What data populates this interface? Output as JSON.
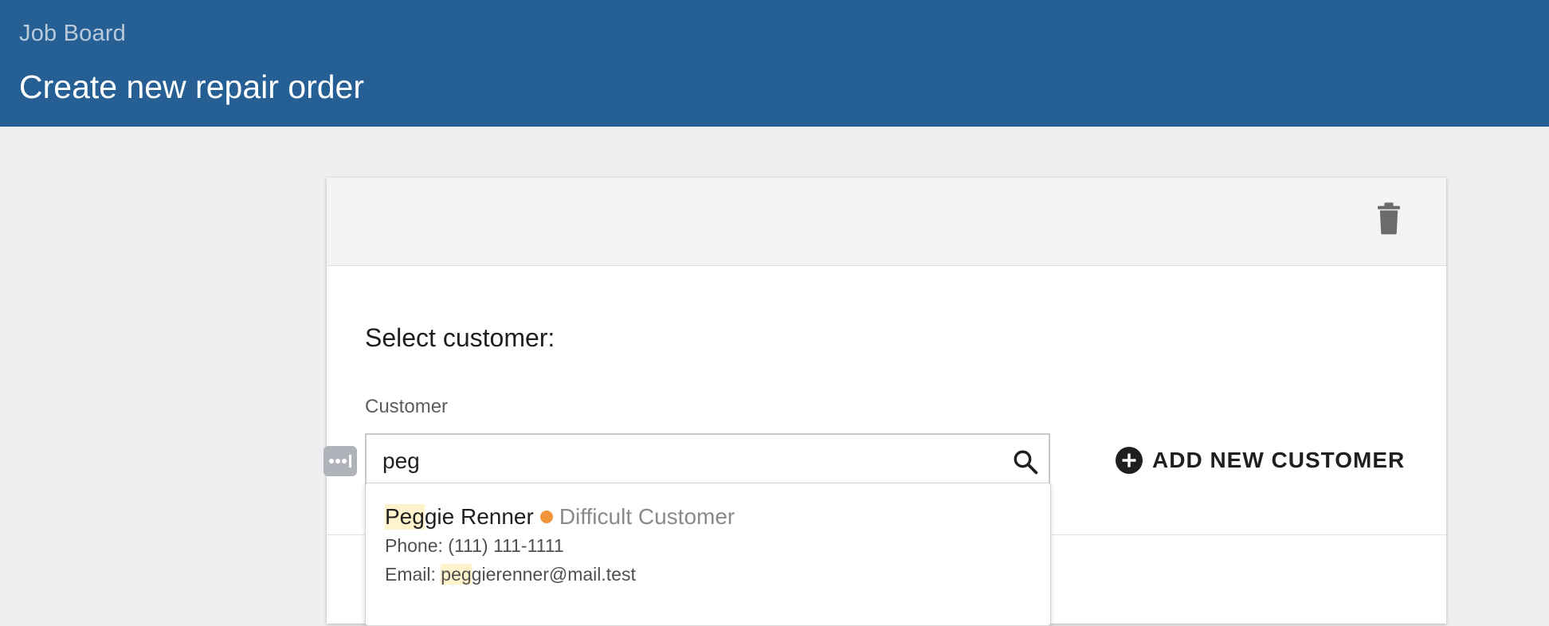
{
  "header": {
    "breadcrumb": "Job Board",
    "title": "Create new repair order",
    "bg_color": "#265f94"
  },
  "card": {
    "delete_icon": "trash-icon"
  },
  "customer_section": {
    "title": "Select customer:",
    "field_label": "Customer",
    "search_value": "peg",
    "search_icon": "search-icon",
    "add_button_icon": "plus-circle-icon",
    "add_button_label": "ADD NEW CUSTOMER"
  },
  "results": [
    {
      "name_match": "Peg",
      "name_rest": "gie Renner",
      "status": "Difficult Customer",
      "status_color": "#f0953a",
      "phone_label": "Phone:",
      "phone": "(111) 111-1111",
      "email_label": "Email:",
      "email_match": "peg",
      "email_rest": "gierenner@mail.test"
    }
  ]
}
